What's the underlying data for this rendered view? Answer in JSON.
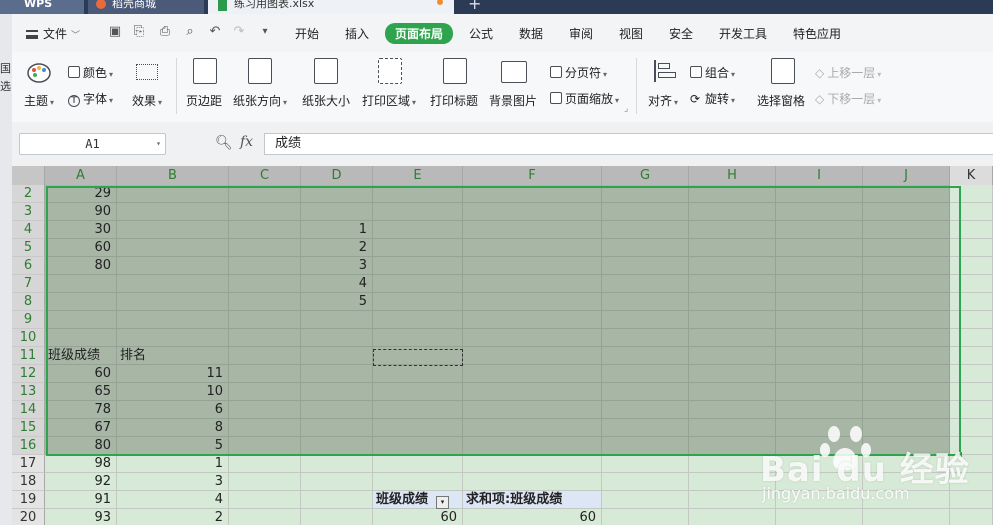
{
  "tabs": [
    {
      "label": "WPS"
    },
    {
      "label": "稻壳商城"
    },
    {
      "label": "练习用图表.xlsx"
    }
  ],
  "left_sliver_chars": [
    "国",
    "选"
  ],
  "menu": {
    "file_label": "文件",
    "tabs": [
      "开始",
      "插入",
      "页面布局",
      "公式",
      "数据",
      "审阅",
      "视图",
      "安全",
      "开发工具",
      "特色应用"
    ],
    "active_tab": "页面布局"
  },
  "ribbon": {
    "color": "颜色",
    "theme": "主题",
    "font": "字体",
    "effects": "效果",
    "margins": "页边距",
    "orientation": "纸张方向",
    "size": "纸张大小",
    "print_area": "打印区域",
    "print_titles": "打印标题",
    "background": "背景图片",
    "page_break": "分页符",
    "page_zoom": "页面缩放",
    "align": "对齐",
    "group": "组合",
    "rotate": "旋转",
    "selection_pane": "选择窗格",
    "bring_forward": "上移一层",
    "send_backward": "下移一层"
  },
  "formula_bar": {
    "name_box": "A1",
    "fx": "fx",
    "content": "成绩"
  },
  "columns": [
    "A",
    "B",
    "C",
    "D",
    "E",
    "F",
    "G",
    "H",
    "I",
    "J",
    "K"
  ],
  "rows": [
    {
      "n": "2",
      "A": "29",
      "B": "",
      "D": "",
      "E": "",
      "F": ""
    },
    {
      "n": "3",
      "A": "90",
      "B": "",
      "D": "",
      "E": "",
      "F": ""
    },
    {
      "n": "4",
      "A": "30",
      "B": "",
      "D": "1",
      "E": "",
      "F": ""
    },
    {
      "n": "5",
      "A": "60",
      "B": "",
      "D": "2",
      "E": "",
      "F": ""
    },
    {
      "n": "6",
      "A": "80",
      "B": "",
      "D": "3",
      "E": "",
      "F": ""
    },
    {
      "n": "7",
      "A": "",
      "B": "",
      "D": "4",
      "E": "",
      "F": ""
    },
    {
      "n": "8",
      "A": "",
      "B": "",
      "D": "5",
      "E": "",
      "F": ""
    },
    {
      "n": "9",
      "A": "",
      "B": "",
      "D": "",
      "E": "",
      "F": ""
    },
    {
      "n": "10",
      "A": "",
      "B": "",
      "D": "",
      "E": "",
      "F": ""
    },
    {
      "n": "11",
      "A": "班级成绩",
      "B": "排名",
      "D": "",
      "E": "",
      "F": ""
    },
    {
      "n": "12",
      "A": "60",
      "B": "11",
      "D": "",
      "E": "",
      "F": ""
    },
    {
      "n": "13",
      "A": "65",
      "B": "10",
      "D": "",
      "E": "",
      "F": ""
    },
    {
      "n": "14",
      "A": "78",
      "B": "6",
      "D": "",
      "E": "",
      "F": ""
    },
    {
      "n": "15",
      "A": "67",
      "B": "8",
      "D": "",
      "E": "",
      "F": ""
    },
    {
      "n": "16",
      "A": "80",
      "B": "5",
      "D": "",
      "E": "",
      "F": ""
    },
    {
      "n": "17",
      "A": "98",
      "B": "1",
      "D": "",
      "E": "",
      "F": ""
    },
    {
      "n": "18",
      "A": "92",
      "B": "3",
      "D": "",
      "E": "",
      "F": ""
    },
    {
      "n": "19",
      "A": "91",
      "B": "4",
      "D": "",
      "E": "班级成绩",
      "F": "求和项:班级成绩"
    },
    {
      "n": "20",
      "A": "93",
      "B": "2",
      "D": "",
      "E": "60",
      "F": "60"
    }
  ],
  "watermark": {
    "main": "Bai du 经验",
    "sub": "jingyan.baidu.com"
  },
  "colors": {
    "accent": "#2ea44f",
    "selection_fill": "#a7b6a5",
    "sheet_tint": "#d7ead7"
  }
}
